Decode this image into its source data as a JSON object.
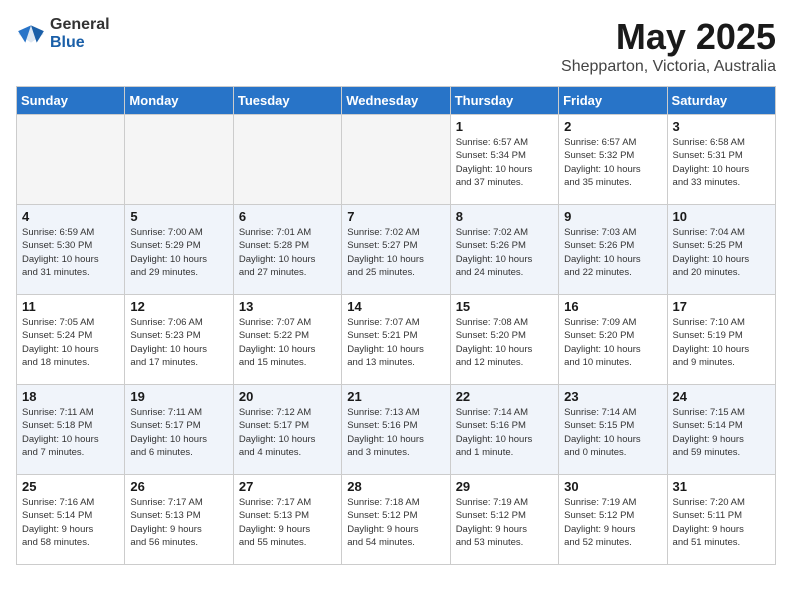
{
  "header": {
    "logo_general": "General",
    "logo_blue": "Blue",
    "title": "May 2025",
    "subtitle": "Shepparton, Victoria, Australia"
  },
  "days_of_week": [
    "Sunday",
    "Monday",
    "Tuesday",
    "Wednesday",
    "Thursday",
    "Friday",
    "Saturday"
  ],
  "weeks": [
    [
      {
        "day": "",
        "text": ""
      },
      {
        "day": "",
        "text": ""
      },
      {
        "day": "",
        "text": ""
      },
      {
        "day": "",
        "text": ""
      },
      {
        "day": "1",
        "text": "Sunrise: 6:57 AM\nSunset: 5:34 PM\nDaylight: 10 hours\nand 37 minutes."
      },
      {
        "day": "2",
        "text": "Sunrise: 6:57 AM\nSunset: 5:32 PM\nDaylight: 10 hours\nand 35 minutes."
      },
      {
        "day": "3",
        "text": "Sunrise: 6:58 AM\nSunset: 5:31 PM\nDaylight: 10 hours\nand 33 minutes."
      }
    ],
    [
      {
        "day": "4",
        "text": "Sunrise: 6:59 AM\nSunset: 5:30 PM\nDaylight: 10 hours\nand 31 minutes."
      },
      {
        "day": "5",
        "text": "Sunrise: 7:00 AM\nSunset: 5:29 PM\nDaylight: 10 hours\nand 29 minutes."
      },
      {
        "day": "6",
        "text": "Sunrise: 7:01 AM\nSunset: 5:28 PM\nDaylight: 10 hours\nand 27 minutes."
      },
      {
        "day": "7",
        "text": "Sunrise: 7:02 AM\nSunset: 5:27 PM\nDaylight: 10 hours\nand 25 minutes."
      },
      {
        "day": "8",
        "text": "Sunrise: 7:02 AM\nSunset: 5:26 PM\nDaylight: 10 hours\nand 24 minutes."
      },
      {
        "day": "9",
        "text": "Sunrise: 7:03 AM\nSunset: 5:26 PM\nDaylight: 10 hours\nand 22 minutes."
      },
      {
        "day": "10",
        "text": "Sunrise: 7:04 AM\nSunset: 5:25 PM\nDaylight: 10 hours\nand 20 minutes."
      }
    ],
    [
      {
        "day": "11",
        "text": "Sunrise: 7:05 AM\nSunset: 5:24 PM\nDaylight: 10 hours\nand 18 minutes."
      },
      {
        "day": "12",
        "text": "Sunrise: 7:06 AM\nSunset: 5:23 PM\nDaylight: 10 hours\nand 17 minutes."
      },
      {
        "day": "13",
        "text": "Sunrise: 7:07 AM\nSunset: 5:22 PM\nDaylight: 10 hours\nand 15 minutes."
      },
      {
        "day": "14",
        "text": "Sunrise: 7:07 AM\nSunset: 5:21 PM\nDaylight: 10 hours\nand 13 minutes."
      },
      {
        "day": "15",
        "text": "Sunrise: 7:08 AM\nSunset: 5:20 PM\nDaylight: 10 hours\nand 12 minutes."
      },
      {
        "day": "16",
        "text": "Sunrise: 7:09 AM\nSunset: 5:20 PM\nDaylight: 10 hours\nand 10 minutes."
      },
      {
        "day": "17",
        "text": "Sunrise: 7:10 AM\nSunset: 5:19 PM\nDaylight: 10 hours\nand 9 minutes."
      }
    ],
    [
      {
        "day": "18",
        "text": "Sunrise: 7:11 AM\nSunset: 5:18 PM\nDaylight: 10 hours\nand 7 minutes."
      },
      {
        "day": "19",
        "text": "Sunrise: 7:11 AM\nSunset: 5:17 PM\nDaylight: 10 hours\nand 6 minutes."
      },
      {
        "day": "20",
        "text": "Sunrise: 7:12 AM\nSunset: 5:17 PM\nDaylight: 10 hours\nand 4 minutes."
      },
      {
        "day": "21",
        "text": "Sunrise: 7:13 AM\nSunset: 5:16 PM\nDaylight: 10 hours\nand 3 minutes."
      },
      {
        "day": "22",
        "text": "Sunrise: 7:14 AM\nSunset: 5:16 PM\nDaylight: 10 hours\nand 1 minute."
      },
      {
        "day": "23",
        "text": "Sunrise: 7:14 AM\nSunset: 5:15 PM\nDaylight: 10 hours\nand 0 minutes."
      },
      {
        "day": "24",
        "text": "Sunrise: 7:15 AM\nSunset: 5:14 PM\nDaylight: 9 hours\nand 59 minutes."
      }
    ],
    [
      {
        "day": "25",
        "text": "Sunrise: 7:16 AM\nSunset: 5:14 PM\nDaylight: 9 hours\nand 58 minutes."
      },
      {
        "day": "26",
        "text": "Sunrise: 7:17 AM\nSunset: 5:13 PM\nDaylight: 9 hours\nand 56 minutes."
      },
      {
        "day": "27",
        "text": "Sunrise: 7:17 AM\nSunset: 5:13 PM\nDaylight: 9 hours\nand 55 minutes."
      },
      {
        "day": "28",
        "text": "Sunrise: 7:18 AM\nSunset: 5:12 PM\nDaylight: 9 hours\nand 54 minutes."
      },
      {
        "day": "29",
        "text": "Sunrise: 7:19 AM\nSunset: 5:12 PM\nDaylight: 9 hours\nand 53 minutes."
      },
      {
        "day": "30",
        "text": "Sunrise: 7:19 AM\nSunset: 5:12 PM\nDaylight: 9 hours\nand 52 minutes."
      },
      {
        "day": "31",
        "text": "Sunrise: 7:20 AM\nSunset: 5:11 PM\nDaylight: 9 hours\nand 51 minutes."
      }
    ]
  ]
}
